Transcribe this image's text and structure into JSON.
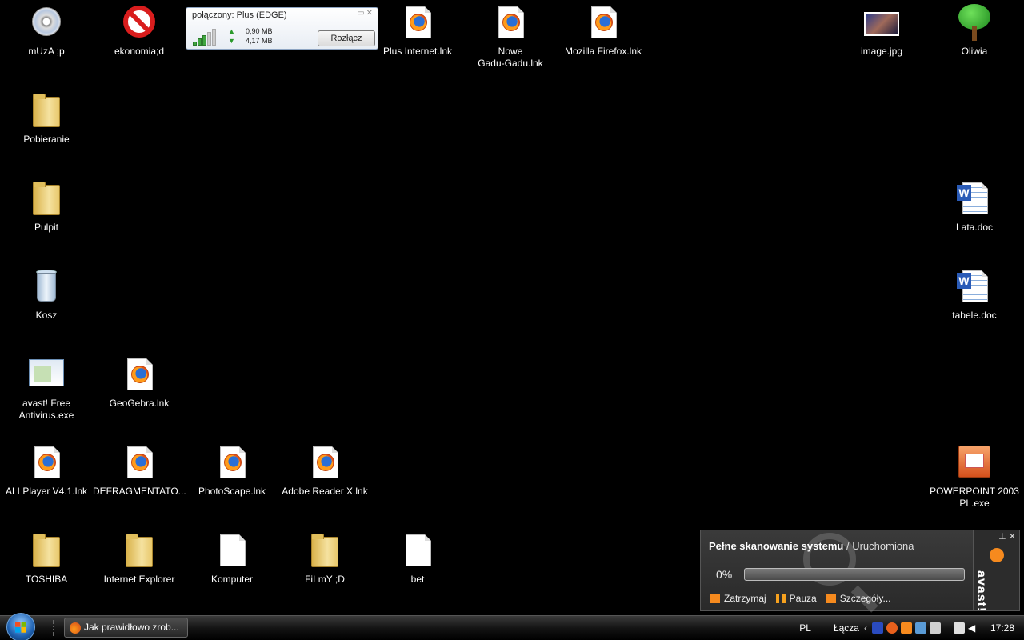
{
  "desktop": {
    "icons": [
      {
        "label": "mUzA ;p",
        "icon": "cd-icon"
      },
      {
        "label": "ekonomia;d",
        "icon": "no-entry-icon"
      },
      {
        "label": "Plus Internet.lnk",
        "icon": "firefox-icon"
      },
      {
        "label": "Nowe\nGadu-Gadu.lnk",
        "icon": "firefox-icon"
      },
      {
        "label": "Mozilla Firefox.lnk",
        "icon": "firefox-icon"
      },
      {
        "label": "image.jpg",
        "icon": "photo-icon"
      },
      {
        "label": "Oliwia",
        "icon": "tree-icon"
      },
      {
        "label": "Pobieranie",
        "icon": "folder-icon"
      },
      {
        "label": "Pulpit",
        "icon": "folder-icon"
      },
      {
        "label": "Kosz",
        "icon": "recycle-bin-icon"
      },
      {
        "label": "Lata.doc",
        "icon": "word-doc-icon"
      },
      {
        "label": "tabele.doc",
        "icon": "word-doc-icon"
      },
      {
        "label": "avast! Free\nAntivirus.exe",
        "icon": "app-window-icon"
      },
      {
        "label": "GeoGebra.lnk",
        "icon": "firefox-icon"
      },
      {
        "label": "ALLPlayer V4.1.lnk",
        "icon": "firefox-icon"
      },
      {
        "label": "DEFRAGMENTATO...",
        "icon": "firefox-icon"
      },
      {
        "label": "PhotoScape.lnk",
        "icon": "firefox-icon"
      },
      {
        "label": "Adobe Reader X.lnk",
        "icon": "firefox-icon"
      },
      {
        "label": "POWERPOINT 2003\nPL.exe",
        "icon": "powerpoint-icon"
      },
      {
        "label": "TOSHIBA",
        "icon": "folder-icon"
      },
      {
        "label": "Internet Explorer",
        "icon": "folder-icon"
      },
      {
        "label": "Komputer",
        "icon": "blank-file-icon"
      },
      {
        "label": "FiLmY ;D",
        "icon": "folder-icon"
      },
      {
        "label": "bet",
        "icon": "blank-file-icon"
      }
    ]
  },
  "connection_widget": {
    "title": "połączony: Plus (EDGE)",
    "upload": "0,90 MB",
    "download": "4,17 MB",
    "disconnect_label": "Rozłącz",
    "signal_level": 0.6
  },
  "avast": {
    "scan_title": "Pełne skanowanie systemu",
    "separator": " / ",
    "scan_status": "Uruchomiona",
    "progress_text": "0%",
    "progress": 0,
    "stop_label": "Zatrzymaj",
    "pause_label": "Pauza",
    "details_label": "Szczegóły...",
    "brand": "avast!",
    "accent": "#f68a1e"
  },
  "taskbar": {
    "task_label": "Jak prawidłowo zrob...",
    "language": "PL",
    "links_label": "Łącza",
    "clock": "17:28"
  }
}
